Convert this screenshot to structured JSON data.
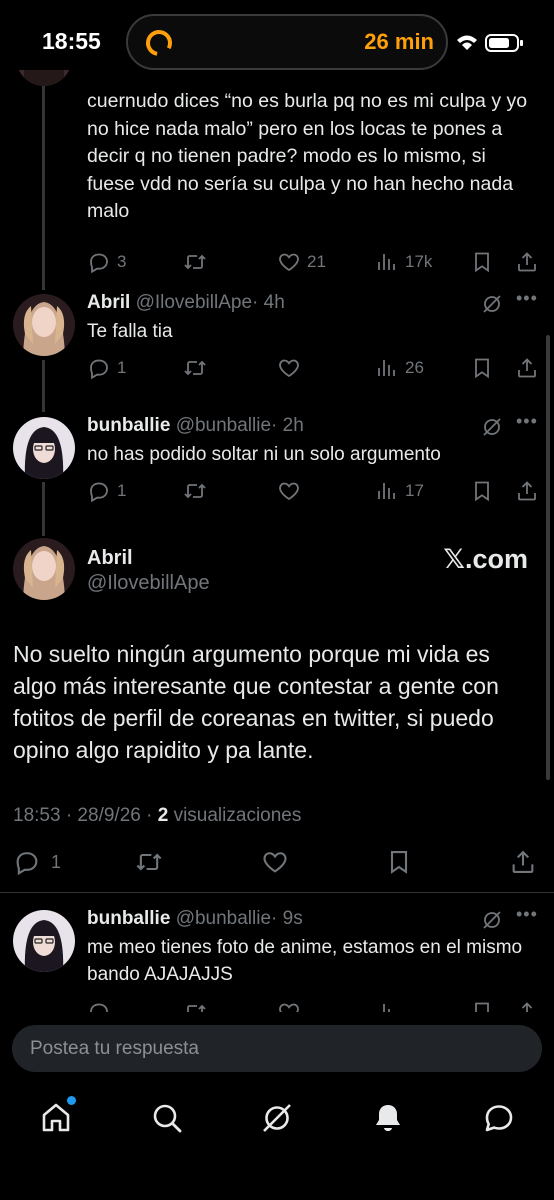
{
  "status_bar": {
    "time": "18:55",
    "timer": "26 min"
  },
  "top_reply": {
    "text": "cuernudo dices “no es burla pq no es mi culpa y yo no hice nada malo” pero en los locas te pones a decir q no tienen padre? modo es lo mismo, si fuese vdd no sería su culpa y no han hecho nada malo",
    "replies": "3",
    "retweets": "",
    "likes": "21",
    "views": "17k"
  },
  "reply_abril": {
    "name": "Abril",
    "handle": "@IlovebillApe",
    "time": "· 4h",
    "text": "Te falla tia",
    "replies": "1",
    "likes": "",
    "views": "26"
  },
  "reply_bunballie_1": {
    "name": "bunballie",
    "handle": "@bunballie",
    "time": "· 2h",
    "text": "no has podido soltar ni un solo argumento",
    "replies": "1",
    "likes": "",
    "views": "17"
  },
  "main_tweet": {
    "name": "Abril",
    "handle": "@IlovebillApe",
    "source_badge": "𝕏.com",
    "body": "No suelto ningún argumento porque mi vida es algo más interesante que contestar a gente con fotitos de perfil de coreanas en twitter, si puedo opino algo rapidito  y pa lante.",
    "timestamp": "18:53 · 28/9/26 · ",
    "views_count": "2",
    "views_label": " visualizaciones",
    "replies": "1"
  },
  "reply_bunballie_2": {
    "name": "bunballie",
    "handle": "@bunballie",
    "time": "· 9s",
    "text": "me meo tienes foto de anime, estamos en el mismo bando AJAJAJJS"
  },
  "composer": {
    "placeholder": "Postea tu respuesta"
  },
  "icons": {
    "reply": "reply-icon",
    "retweet": "retweet-icon",
    "like": "heart-icon",
    "views": "views-icon",
    "bookmark": "bookmark-icon",
    "share": "share-icon",
    "grok": "grok-icon",
    "more": "more-icon",
    "nav": [
      "home-icon",
      "search-icon",
      "grok-icon",
      "notifications-icon",
      "messages-icon"
    ]
  },
  "colors": {
    "accent": "#1d9bf0",
    "muted": "#71767b",
    "text": "#e7e9ea",
    "timer": "#ff9f0a"
  }
}
